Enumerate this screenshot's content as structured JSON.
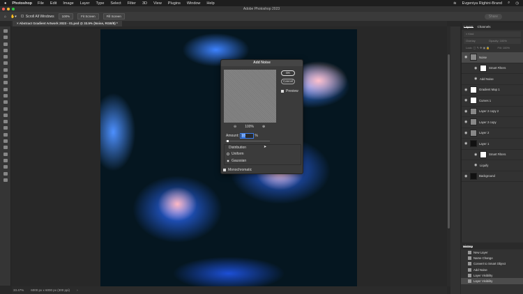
{
  "menubar": {
    "app": "Photoshop",
    "items": [
      "File",
      "Edit",
      "Image",
      "Layer",
      "Type",
      "Select",
      "Filter",
      "3D",
      "View",
      "Plugins",
      "Window",
      "Help"
    ],
    "user": "Evgeniya Righini-Brand"
  },
  "window": {
    "title": "Adobe Photoshop 2023"
  },
  "options": {
    "scroll_all": "Scroll All Windows",
    "zoom100": "100%",
    "fit": "Fit Screen",
    "fill": "Fill Screen",
    "share": "Share"
  },
  "document": {
    "tab": "Abstract Gradient Artwork 2023 - 01.psd @ 33.5% (Noise, RGB/8) *",
    "zoom": "33.47%",
    "size": "6000 px x 6000 px (300 ppi)"
  },
  "layers_panel": {
    "tabs": [
      "Layers",
      "Channels"
    ],
    "filter": "Kind",
    "blend": "Overlay",
    "opacity_label": "Opacity:",
    "opacity": "100%",
    "lock_label": "Lock:",
    "fill_label": "Fill:",
    "fill": "100%",
    "layers": [
      {
        "name": "Noise",
        "thumb": "g",
        "selected": true,
        "sub": false
      },
      {
        "name": "Smart Filters",
        "thumb": "w",
        "sub": true
      },
      {
        "name": "Add Noise",
        "thumb": "",
        "sub": true
      },
      {
        "name": "Gradient Map 1",
        "thumb": "w",
        "sub": false
      },
      {
        "name": "Curves 1",
        "thumb": "w",
        "sub": false
      },
      {
        "name": "Layer 2 copy 2",
        "thumb": "g",
        "sub": false
      },
      {
        "name": "Layer 2 copy",
        "thumb": "g",
        "sub": false
      },
      {
        "name": "Layer 2",
        "thumb": "g",
        "sub": false
      },
      {
        "name": "Layer 1",
        "thumb": "k",
        "sub": false
      },
      {
        "name": "Smart Filters",
        "thumb": "w",
        "sub": true
      },
      {
        "name": "Liquify",
        "thumb": "",
        "sub": true
      },
      {
        "name": "Background",
        "thumb": "k",
        "sub": false
      }
    ]
  },
  "history": {
    "title": "History",
    "items": [
      "New Layer",
      "Name Change",
      "Convert to Smart Object",
      "Add Noise",
      "Layer Visibility",
      "Layer Visibility"
    ]
  },
  "dialog": {
    "title": "Add Noise",
    "ok": "OK",
    "cancel": "Cancel",
    "preview": "Preview",
    "zoom": "100%",
    "amount_label": "Amount:",
    "amount": "10",
    "unit": "%",
    "amount_fraction": 0.1,
    "distribution": "Distribution",
    "uniform": "Uniform",
    "gaussian": "Gaussian",
    "mono": "Monochromatic"
  }
}
